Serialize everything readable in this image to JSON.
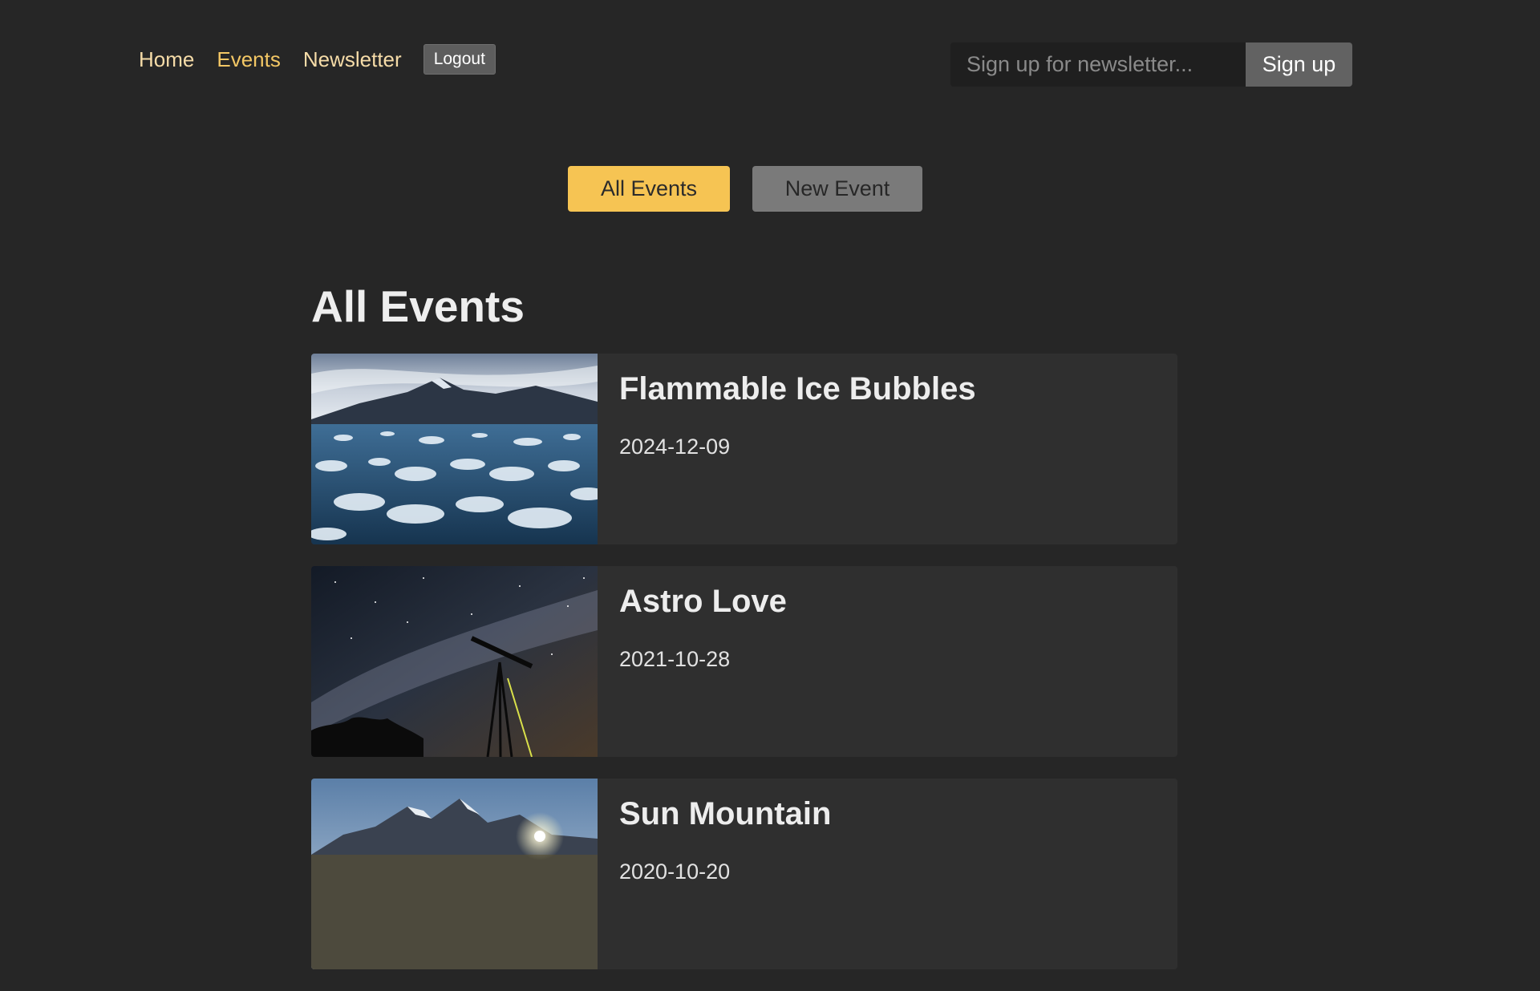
{
  "nav": {
    "home": "Home",
    "events": "Events",
    "newsletter": "Newsletter",
    "logout": "Logout"
  },
  "newsletter_form": {
    "placeholder": "Sign up for newsletter...",
    "button": "Sign up"
  },
  "event_tabs": {
    "all": "All Events",
    "new": "New Event"
  },
  "page_title": "All Events",
  "events": [
    {
      "title": "Flammable Ice Bubbles",
      "date": "2024-12-09",
      "image": "frozen-lake-ice-bubbles"
    },
    {
      "title": "Astro Love",
      "date": "2021-10-28",
      "image": "telescope-night-sky"
    },
    {
      "title": "Sun Mountain",
      "date": "2020-10-20",
      "image": "mountain-sunrise"
    }
  ],
  "colors": {
    "background": "#262626",
    "card": "#2f2f2f",
    "accent": "#f6c453",
    "nav_link": "#f6dca8"
  }
}
